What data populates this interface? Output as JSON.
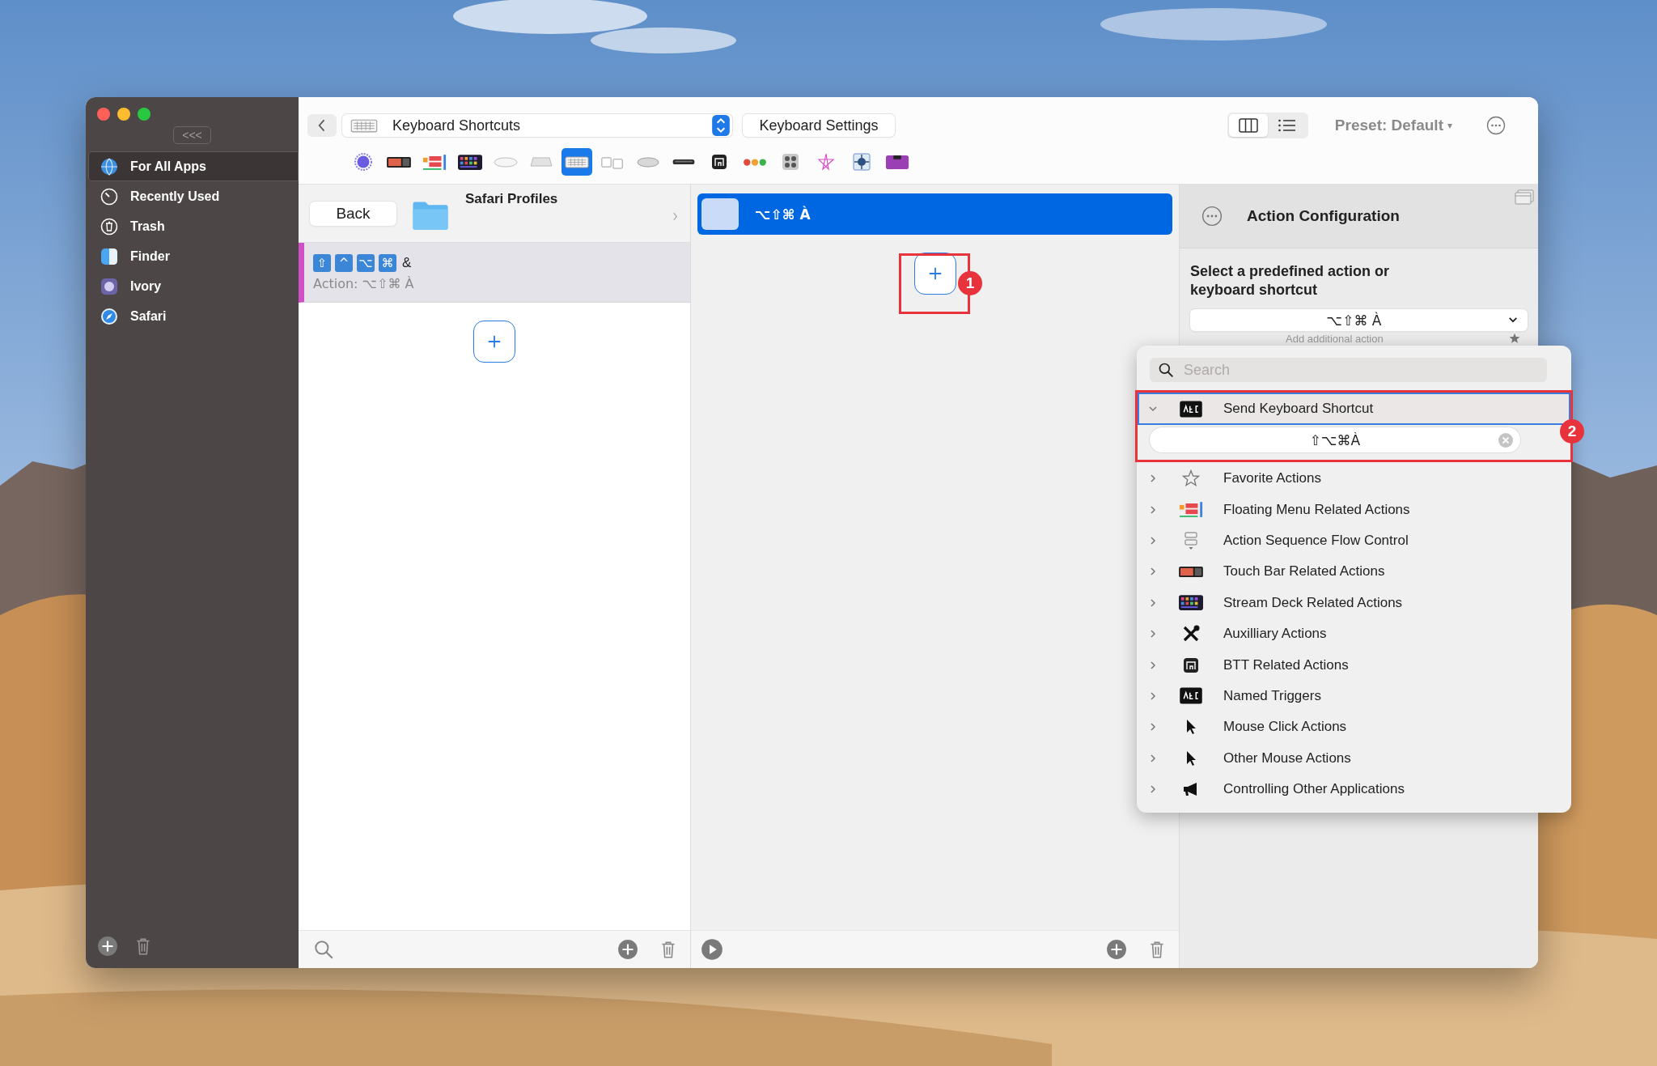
{
  "window": {
    "controls": [
      {
        "kind": "close"
      },
      {
        "kind": "minimize"
      },
      {
        "kind": "zoom"
      }
    ]
  },
  "sidebar": {
    "collapse_label": "<<<",
    "items": [
      {
        "label": "For All Apps",
        "kind": "globe",
        "selected": true
      },
      {
        "label": "Recently Used",
        "kind": "clock",
        "selected": false
      },
      {
        "label": "Trash",
        "kind": "trash",
        "selected": false
      },
      {
        "label": "Finder",
        "kind": "finder",
        "selected": false
      },
      {
        "label": "Ivory",
        "kind": "ivory",
        "selected": false
      },
      {
        "label": "Safari",
        "kind": "safari",
        "selected": false
      }
    ]
  },
  "toolbar": {
    "trigger_select": {
      "value": "Keyboard Shortcuts"
    },
    "settings_button": "Keyboard Settings",
    "view_modes": [
      {
        "kind": "columns",
        "selected": true
      },
      {
        "kind": "list",
        "selected": false
      }
    ],
    "preset": "Preset: Default",
    "preset_caret": "▾"
  },
  "trigger_types": [
    {
      "kind": "ring",
      "selected": false
    },
    {
      "kind": "touch-bar",
      "selected": false
    },
    {
      "kind": "floating-menu",
      "selected": false
    },
    {
      "kind": "stream-deck",
      "selected": false
    },
    {
      "kind": "magic-mouse",
      "selected": false
    },
    {
      "kind": "trackpad",
      "selected": false
    },
    {
      "kind": "keyboard",
      "selected": true
    },
    {
      "kind": "key-sequence",
      "selected": false
    },
    {
      "kind": "mouse",
      "selected": false
    },
    {
      "kind": "remote",
      "selected": false
    },
    {
      "kind": "btt",
      "selected": false
    },
    {
      "kind": "dots",
      "selected": false
    },
    {
      "kind": "keypad",
      "selected": false
    },
    {
      "kind": "star",
      "selected": false
    },
    {
      "kind": "circuit",
      "selected": false
    },
    {
      "kind": "notch-bar",
      "selected": false
    }
  ],
  "triggers": {
    "back_button": "Back",
    "folder": "Safari Profiles",
    "items": [
      {
        "keys": [
          "⇧",
          "^",
          "⌥",
          "⌘"
        ],
        "key": "&",
        "action": "Action: ⌥⇧⌘ À",
        "selected": true
      }
    ]
  },
  "actions": {
    "items": [
      {
        "label": "⌥⇧⌘ À",
        "selected": true
      }
    ]
  },
  "config": {
    "title": "Action Configuration",
    "prompt": "Select a predefined action or keyboard shortcut",
    "value": "⌥⇧⌘ À",
    "add_label": "Add additional action"
  },
  "action_menu": {
    "search": {
      "placeholder": "Search"
    },
    "items": [
      {
        "label": "Send Keyboard Shortcut",
        "kind": "tag",
        "expanded": true,
        "selected": true,
        "shortcut_field": {
          "value": "⇧⌥⌘À"
        }
      },
      {
        "label": "Favorite Actions",
        "kind": "star",
        "expanded": false,
        "selected": false
      },
      {
        "label": "Floating Menu Related Actions",
        "kind": "floating-menu",
        "expanded": false,
        "selected": false
      },
      {
        "label": "Action Sequence Flow Control",
        "kind": "flow",
        "expanded": false,
        "selected": false
      },
      {
        "label": "Touch Bar Related Actions",
        "kind": "touch-bar",
        "expanded": false,
        "selected": false
      },
      {
        "label": "Stream Deck Related Actions",
        "kind": "stream-deck",
        "expanded": false,
        "selected": false
      },
      {
        "label": "Auxilliary Actions",
        "kind": "tools",
        "expanded": false,
        "selected": false
      },
      {
        "label": "BTT Related Actions",
        "kind": "btt",
        "expanded": false,
        "selected": false
      },
      {
        "label": "Named Triggers",
        "kind": "tag",
        "expanded": false,
        "selected": false
      },
      {
        "label": "Mouse Click Actions",
        "kind": "cursor",
        "expanded": false,
        "selected": false
      },
      {
        "label": "Other Mouse Actions",
        "kind": "cursor",
        "expanded": false,
        "selected": false
      },
      {
        "label": "Controlling Other Applications",
        "kind": "megaphone",
        "expanded": false,
        "selected": false
      }
    ]
  },
  "annotations": [
    {
      "label": "1"
    },
    {
      "label": "2"
    }
  ]
}
